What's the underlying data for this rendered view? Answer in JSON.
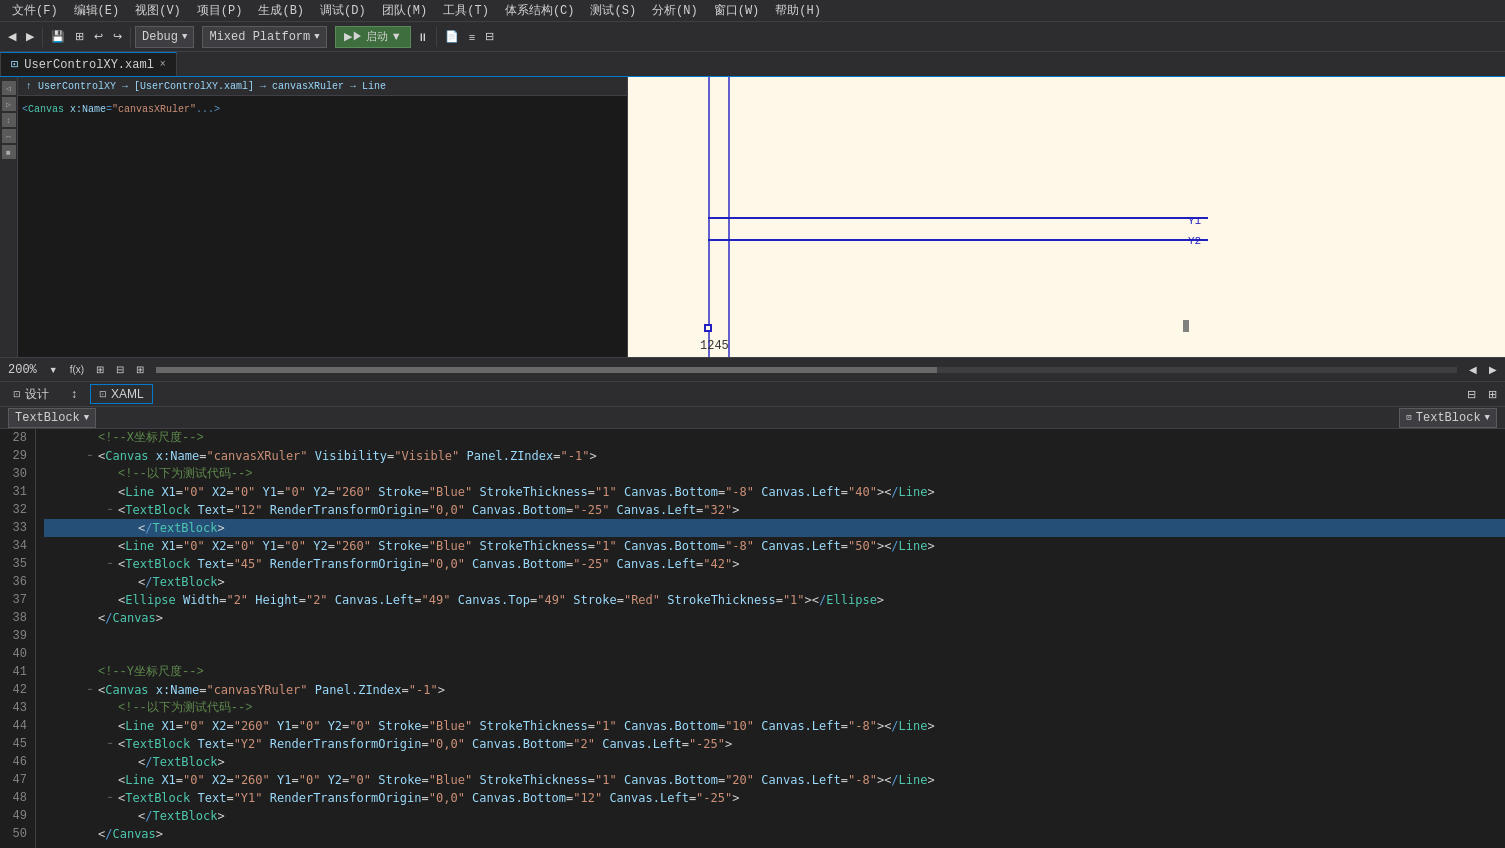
{
  "menubar": {
    "items": [
      "文件(F)",
      "编辑(E)",
      "视图(V)",
      "项目(P)",
      "生成(B)",
      "调试(D)",
      "团队(M)",
      "工具(T)",
      "体系结构(C)",
      "测试(S)",
      "分析(N)",
      "窗口(W)",
      "帮助(H)"
    ]
  },
  "toolbar": {
    "debug_config": "Debug",
    "platform_config": "Mixed Platform",
    "start_label": "▶ 启动 ▼",
    "zoom_label": "200%"
  },
  "tab": {
    "filename": "UserControlXY.xaml",
    "close_icon": "×"
  },
  "designer": {
    "breadcrumb": "↑ UserControlXY → [UserControlXY.xaml] → canvasXRuler → Line",
    "y1_label": "Y1",
    "y2_label": "Y2",
    "x_label": "1245"
  },
  "view_toggles": {
    "design_label": "设计",
    "xaml_label": "XAML"
  },
  "editor_header": {
    "left_dropdown": "TextBlock",
    "right_dropdown": "TextBlock"
  },
  "code_lines": [
    {
      "num": 28,
      "indent": 2,
      "fold": false,
      "content": "<!--X坐标尺度-->",
      "type": "comment"
    },
    {
      "num": 29,
      "indent": 2,
      "fold": true,
      "content": "<Canvas x:Name=\"canvasXRuler\"  Visibility=\"Visible\" Panel.ZIndex=\"-1\">",
      "type": "open-tag"
    },
    {
      "num": 30,
      "indent": 3,
      "fold": false,
      "content": "<!--以下为测试代码-->",
      "type": "comment"
    },
    {
      "num": 31,
      "indent": 3,
      "fold": false,
      "content": "<Line X1=\"0\" X2=\"0\" Y1=\"0\" Y2=\"260\" Stroke=\"Blue\" StrokeThickness=\"1\" Canvas.Bottom=\"-8\"    Canvas.Left=\"40\"></Line>",
      "type": "tag"
    },
    {
      "num": 32,
      "indent": 3,
      "fold": true,
      "content": "<TextBlock Text=\"12\" RenderTransformOrigin=\"0,0\" Canvas.Bottom=\"-25\"    Canvas.Left=\"32\">",
      "type": "open-tag"
    },
    {
      "num": 33,
      "indent": 4,
      "fold": false,
      "content": "</TextBlock>",
      "type": "close-tag",
      "selected": true
    },
    {
      "num": 34,
      "indent": 3,
      "fold": false,
      "content": "<Line X1=\"0\" X2=\"0\" Y1=\"0\" Y2=\"260\" Stroke=\"Blue\" StrokeThickness=\"1\"    Canvas.Bottom=\"-8\"     Canvas.Left=\"50\"></Line>",
      "type": "tag"
    },
    {
      "num": 35,
      "indent": 3,
      "fold": true,
      "content": "<TextBlock Text=\"45\" RenderTransformOrigin=\"0,0\" Canvas.Bottom=\"-25\"    Canvas.Left=\"42\">",
      "type": "open-tag"
    },
    {
      "num": 36,
      "indent": 4,
      "fold": false,
      "content": "</TextBlock>",
      "type": "close-tag"
    },
    {
      "num": 37,
      "indent": 3,
      "fold": false,
      "content": "<Ellipse Width=\"2\" Height=\"2\" Canvas.Left=\"49\" Canvas.Top=\"49\" Stroke=\"Red\" StrokeThickness=\"1\"></Ellipse>",
      "type": "tag"
    },
    {
      "num": 38,
      "indent": 2,
      "fold": false,
      "content": "</Canvas>",
      "type": "close-tag"
    },
    {
      "num": 39,
      "indent": 0,
      "fold": false,
      "content": "",
      "type": "empty"
    },
    {
      "num": 40,
      "indent": 0,
      "fold": false,
      "content": "",
      "type": "empty"
    },
    {
      "num": 41,
      "indent": 2,
      "fold": false,
      "content": "<!--Y坐标尺度-->",
      "type": "comment"
    },
    {
      "num": 42,
      "indent": 2,
      "fold": true,
      "content": "<Canvas x:Name=\"canvasYRuler\" Panel.ZIndex=\"-1\">",
      "type": "open-tag"
    },
    {
      "num": 43,
      "indent": 3,
      "fold": false,
      "content": "<!--以下为测试代码-->",
      "type": "comment"
    },
    {
      "num": 44,
      "indent": 3,
      "fold": false,
      "content": "<Line X1=\"0\" X2=\"260\" Y1=\"0\" Y2=\"0\" Stroke=\"Blue\" StrokeThickness=\"1\" Canvas.Bottom=\"10\"    Canvas.Left=\"-8\"></Line>",
      "type": "tag"
    },
    {
      "num": 45,
      "indent": 3,
      "fold": true,
      "content": "<TextBlock Text=\"Y2\" RenderTransformOrigin=\"0,0\" Canvas.Bottom=\"2\"    Canvas.Left=\"-25\">",
      "type": "open-tag"
    },
    {
      "num": 46,
      "indent": 4,
      "fold": false,
      "content": "</TextBlock>",
      "type": "close-tag"
    },
    {
      "num": 47,
      "indent": 3,
      "fold": false,
      "content": "<Line X1=\"0\" X2=\"260\" Y1=\"0\" Y2=\"0\" Stroke=\"Blue\" StrokeThickness=\"1\" Canvas.Bottom=\"20\"    Canvas.Left=\"-8\"></Line>",
      "type": "tag"
    },
    {
      "num": 48,
      "indent": 3,
      "fold": true,
      "content": "<TextBlock Text=\"Y1\" RenderTransformOrigin=\"0,0\" Canvas.Bottom=\"12\"    Canvas.Left=\"-25\">",
      "type": "open-tag"
    },
    {
      "num": 49,
      "indent": 4,
      "fold": false,
      "content": "</TextBlock>",
      "type": "close-tag"
    },
    {
      "num": 50,
      "indent": 2,
      "fold": false,
      "content": "</Canvas>",
      "type": "close-tag"
    }
  ]
}
